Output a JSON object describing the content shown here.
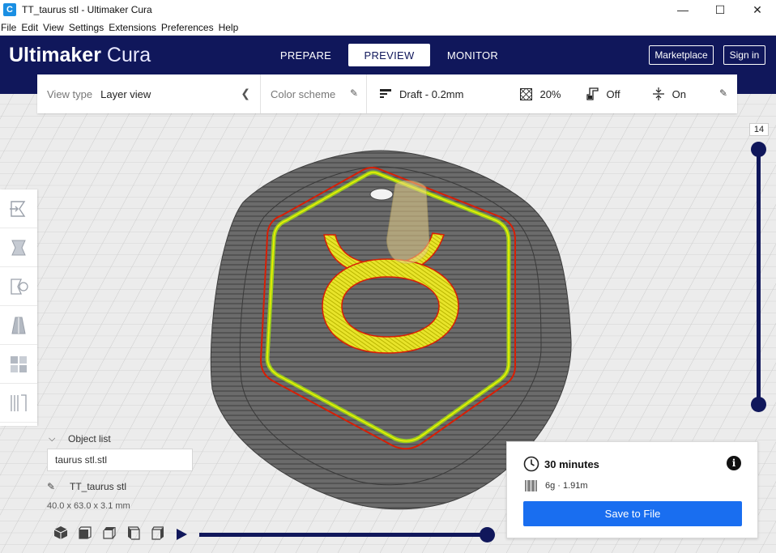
{
  "window": {
    "title": "TT_taurus stl - Ultimaker Cura",
    "app_icon": "C",
    "minimize_icon": "—",
    "maximize_icon": "☐",
    "close_icon": "✕"
  },
  "menu": [
    "File",
    "Edit",
    "View",
    "Settings",
    "Extensions",
    "Preferences",
    "Help"
  ],
  "header": {
    "logo_brand": "Ultimaker",
    "logo_product": "Cura",
    "stages": [
      "PREPARE",
      "PREVIEW",
      "MONITOR"
    ],
    "active_stage": "PREVIEW",
    "marketplace_label": "Marketplace",
    "signin_label": "Sign in"
  },
  "settings_bar": {
    "view_type_label": "View type",
    "view_type_value": "Layer view",
    "color_scheme_label": "Color scheme",
    "profile": "Draft - 0.2mm",
    "infill": "20%",
    "support": "Off",
    "adhesion": "On"
  },
  "tools": [
    "move-tool",
    "scale-tool",
    "rotate-tool",
    "mirror-tool",
    "per-model-settings-tool",
    "support-blocker-tool"
  ],
  "layer_slider": {
    "current_layer": "14"
  },
  "object_list": {
    "label": "Object list",
    "items": [
      "taurus stl.stl"
    ],
    "selected_name": "TT_taurus stl",
    "dimensions": "40.0 x 63.0 x 3.1 mm"
  },
  "view_orientation": [
    "3d-view",
    "front-view",
    "top-view",
    "left-view",
    "right-view"
  ],
  "simulation": {
    "progress": 1.0
  },
  "print_info": {
    "time": "30 minutes",
    "material": "6g · 1.91m",
    "save_label": "Save to File"
  },
  "colors": {
    "header": "#10175b",
    "accent_blue": "#196ef0",
    "wall_outer": "#d81e05",
    "wall_inner": "#9acd1f",
    "top_bottom": "#e6e000",
    "infill": "#555555"
  }
}
